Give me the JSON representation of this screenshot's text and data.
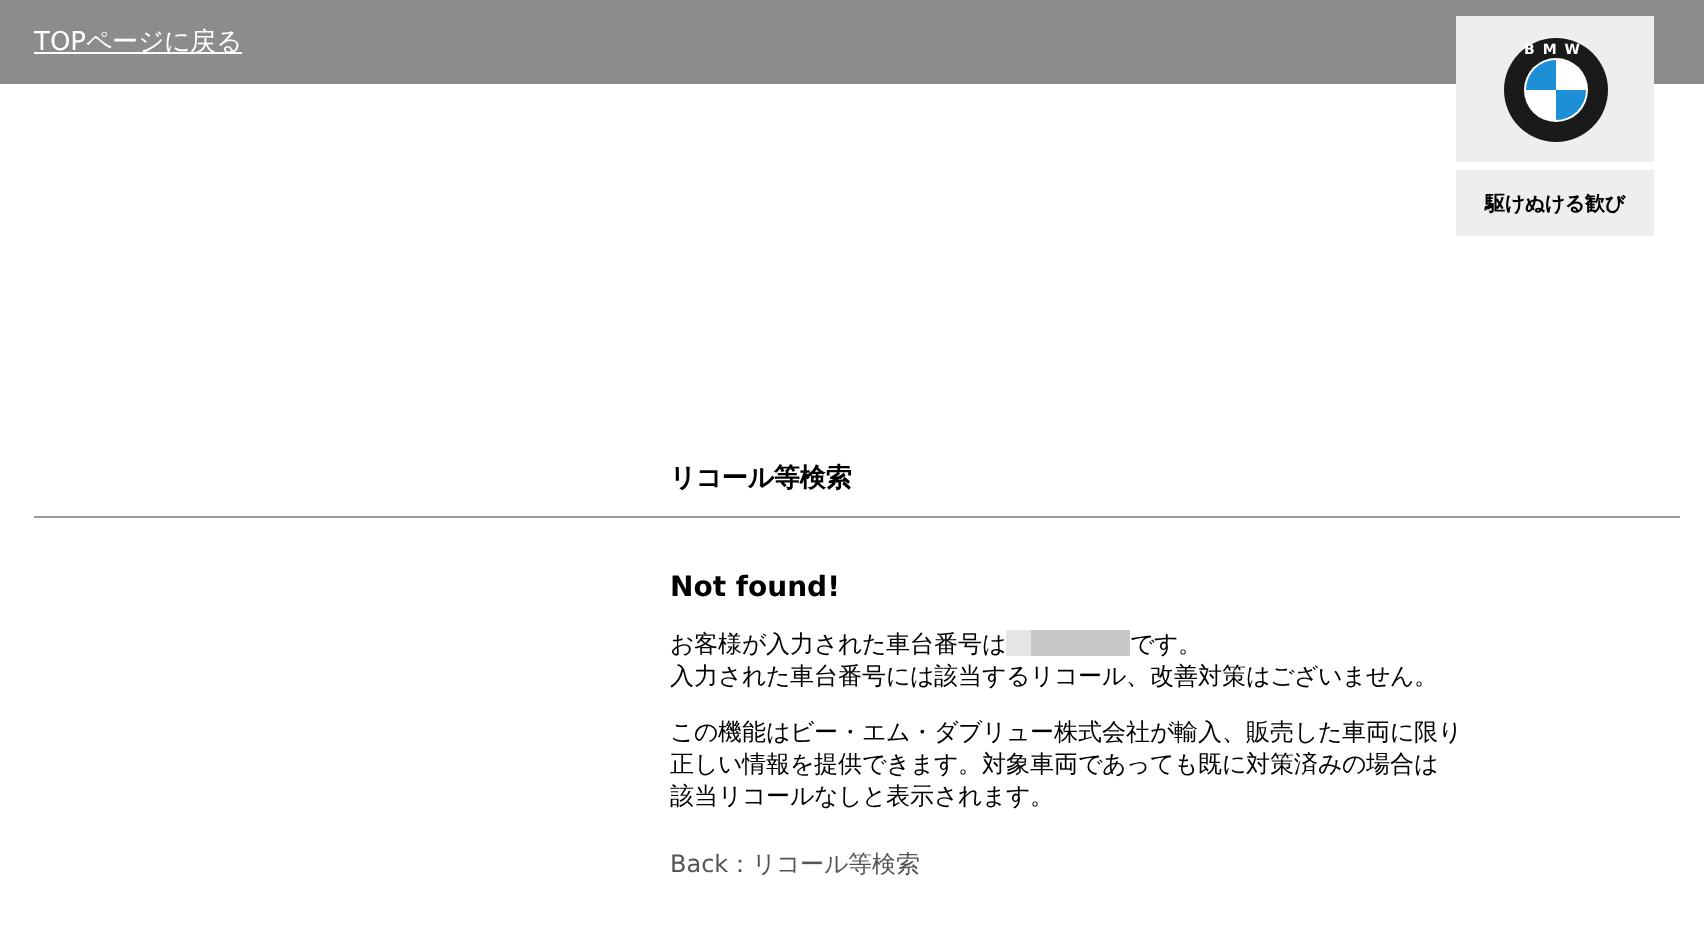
{
  "header": {
    "top_link": "TOPページに戻る"
  },
  "brand": {
    "logo_text": "BMW",
    "tagline": "駆けぬける歓び"
  },
  "page_title": "リコール等検索",
  "result": {
    "heading": "Not found!",
    "vehicle_sentence_before": "お客様が入力された車台番号は",
    "vehicle_sentence_after": "です。",
    "line_2": "入力された車台番号には該当するリコール、改善対策はございません。",
    "notice_lines": [
      "この機能はビー・エム・ダブリュー株式会社が輸入、販売した車両に限り",
      "正しい情報を提供できます。対象車両であっても既に対策済みの場合は",
      "該当リコールなしと表示されます。"
    ]
  },
  "back_link": "Back：リコール等検索"
}
